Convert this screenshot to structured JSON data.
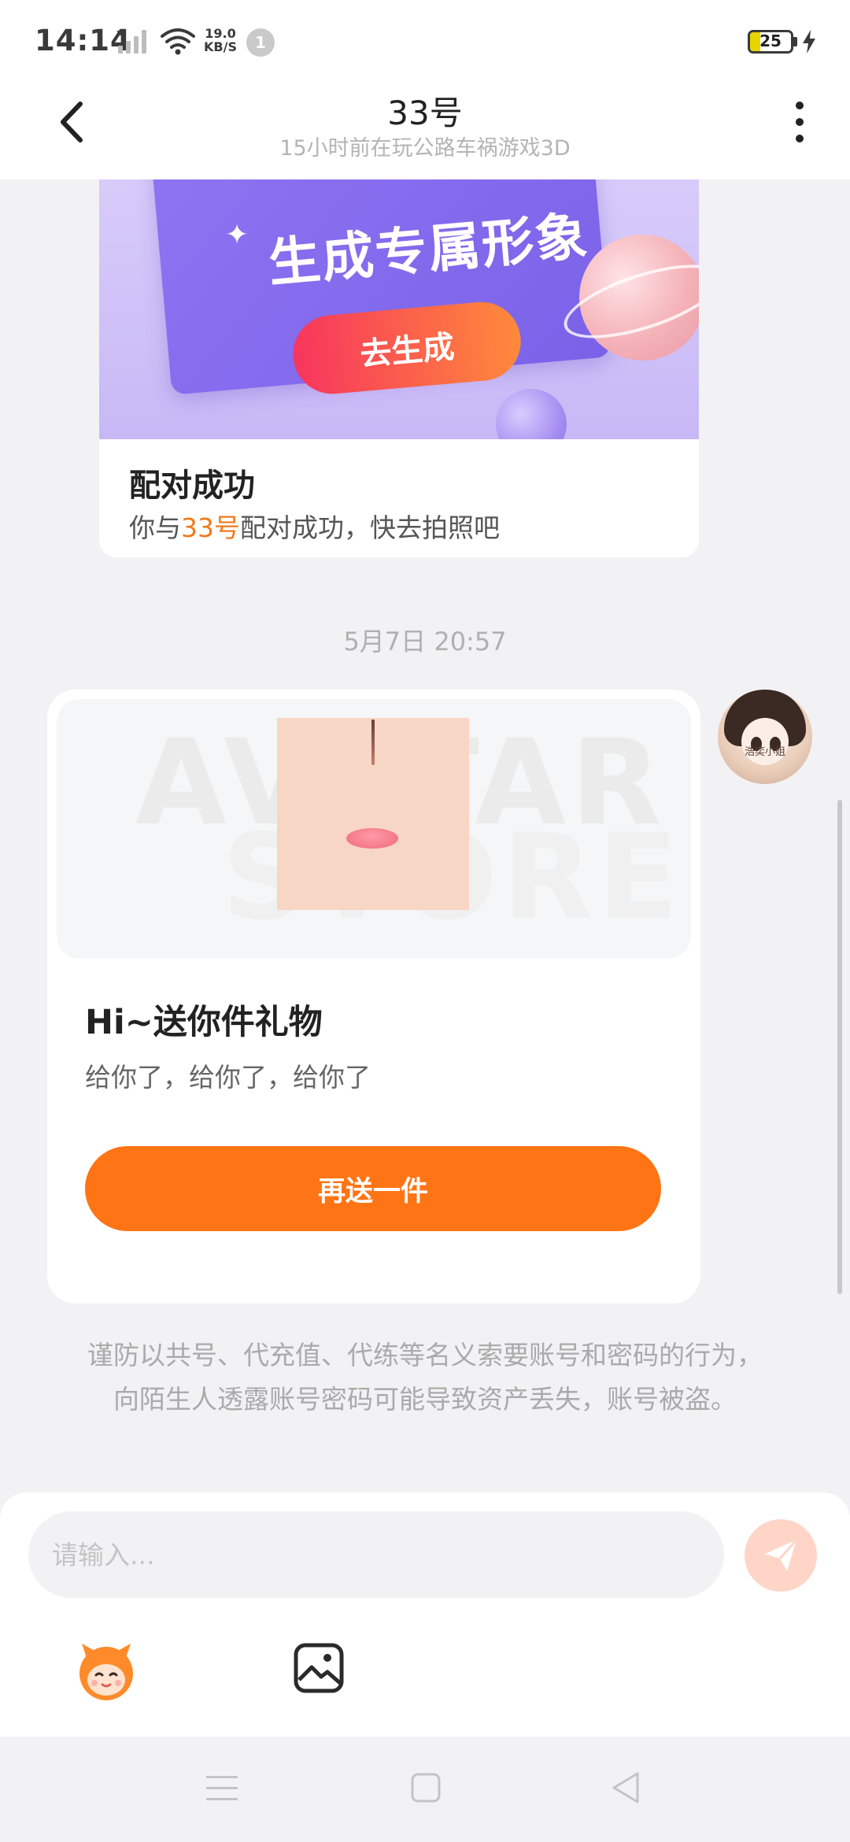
{
  "status_bar": {
    "time": "14:14",
    "net_speed_value": "19.0",
    "net_speed_unit": "KB/S",
    "notification_count": "1",
    "battery": "25"
  },
  "header": {
    "title": "33号",
    "subtitle": "15小时前在玩公路车祸游戏3D"
  },
  "match_card": {
    "banner_headline": "生成专属形象",
    "banner_button": "去生成",
    "title": "配对成功",
    "desc_prefix": "你与",
    "desc_name": "33号",
    "desc_suffix": "配对成功，快去拍照吧"
  },
  "timestamp": "5月7日 20:57",
  "gift_card": {
    "watermark_1": "AVATAR",
    "watermark_2": "STORE",
    "title": "Hi~送你件礼物",
    "message": "给你了，给你了，给你了",
    "button": "再送一件"
  },
  "avatar": {
    "caption": "浩奕小姐"
  },
  "safety_notice": "谨防以共号、代充值、代练等名义索要账号和密码的行为，向陌生人透露账号密码可能导致资产丢失，账号被盗。",
  "input": {
    "placeholder": "请输入..."
  },
  "icons": {
    "back": "chevron-left-icon",
    "more": "more-vertical-icon",
    "send": "paper-plane-icon",
    "emoji": "mascot-emoji-icon",
    "image": "image-icon"
  },
  "colors": {
    "accent": "#ff7414",
    "highlight": "#f07a1e",
    "banner": "#8f74f2"
  }
}
